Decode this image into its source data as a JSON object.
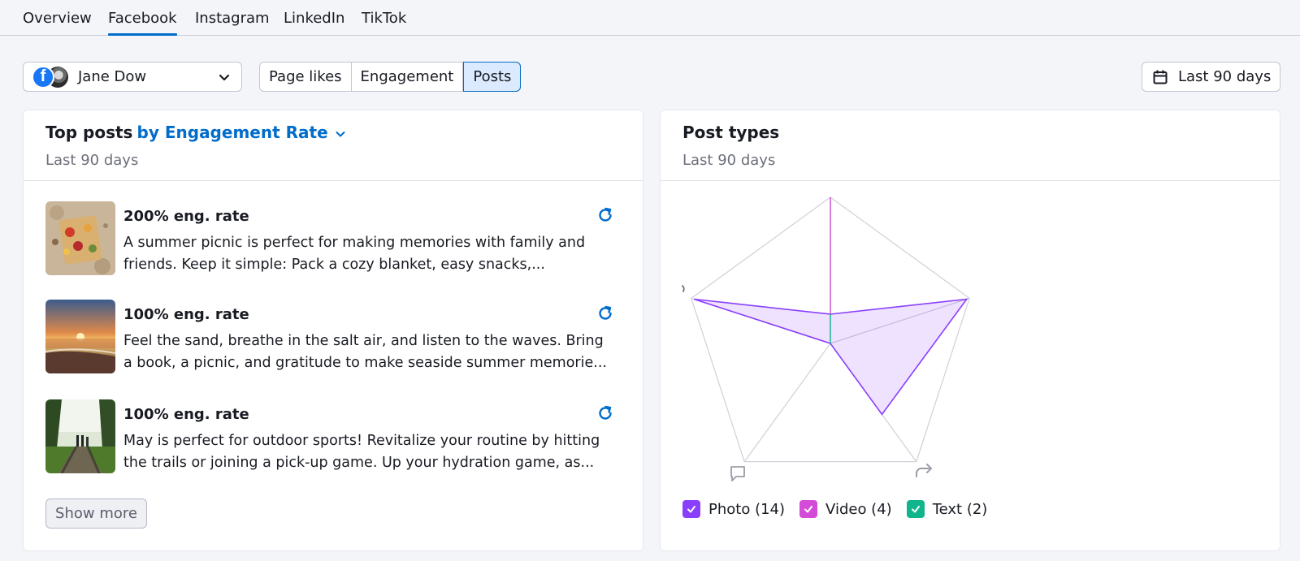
{
  "tabs": [
    {
      "label": "Overview",
      "active": false
    },
    {
      "label": "Facebook",
      "active": true
    },
    {
      "label": "Instagram",
      "active": false
    },
    {
      "label": "LinkedIn",
      "active": false
    },
    {
      "label": "TikTok",
      "active": false
    }
  ],
  "account": {
    "name": "Jane Dow",
    "platform_icon": "facebook-icon"
  },
  "metric_toggle": {
    "options": [
      "Page likes",
      "Engagement",
      "Posts"
    ],
    "selected": "Posts"
  },
  "date_range": {
    "label": "Last 90 days",
    "icon": "calendar-icon"
  },
  "top_posts": {
    "title": "Top posts",
    "sort_link": "by Engagement Rate",
    "subtitle": "Last 90 days",
    "posts": [
      {
        "rate": "200% eng. rate",
        "line1": "A summer picnic is perfect for making memories with family and",
        "line2": "friends. Keep it simple: Pack a cozy blanket, easy snacks,...",
        "thumb": "picnic"
      },
      {
        "rate": "100% eng. rate",
        "line1": "Feel the sand, breathe in the salt air, and listen to the waves. Bring",
        "line2": "a book, a picnic, and gratitude to make seaside summer memorie...",
        "thumb": "sunset"
      },
      {
        "rate": "100% eng. rate",
        "line1": "May is perfect for outdoor sports! Revitalize your routine by hitting",
        "line2": "the trails or joining a pick-up game. Up your hydration game, as...",
        "thumb": "park"
      }
    ],
    "show_more": "Show more"
  },
  "post_types": {
    "title": "Post types",
    "subtitle": "Last 90 days",
    "legend": [
      {
        "label": "Photo (14)",
        "color": "#8a3ffc",
        "checked": true
      },
      {
        "label": "Video (4)",
        "color": "#d44bd8",
        "checked": true
      },
      {
        "label": "Text (2)",
        "color": "#10b58b",
        "checked": true
      }
    ],
    "axis_icons": [
      "like-icon",
      "reach-icon",
      "share-icon",
      "comment-icon",
      "reaction-icon"
    ]
  },
  "chart_data": {
    "type": "radar",
    "axes": 5,
    "max": 1,
    "series": [
      {
        "name": "Photo (14)",
        "color": "#8a3ffc",
        "values": [
          0.2,
          0.98,
          0.6,
          0.0,
          0.98
        ]
      },
      {
        "name": "Video (4)",
        "color": "#d44bd8",
        "values": [
          1.0,
          0,
          0,
          0,
          0
        ]
      },
      {
        "name": "Text (2)",
        "color": "#10b58b",
        "values": [
          0,
          0,
          0,
          0,
          0
        ]
      }
    ]
  }
}
